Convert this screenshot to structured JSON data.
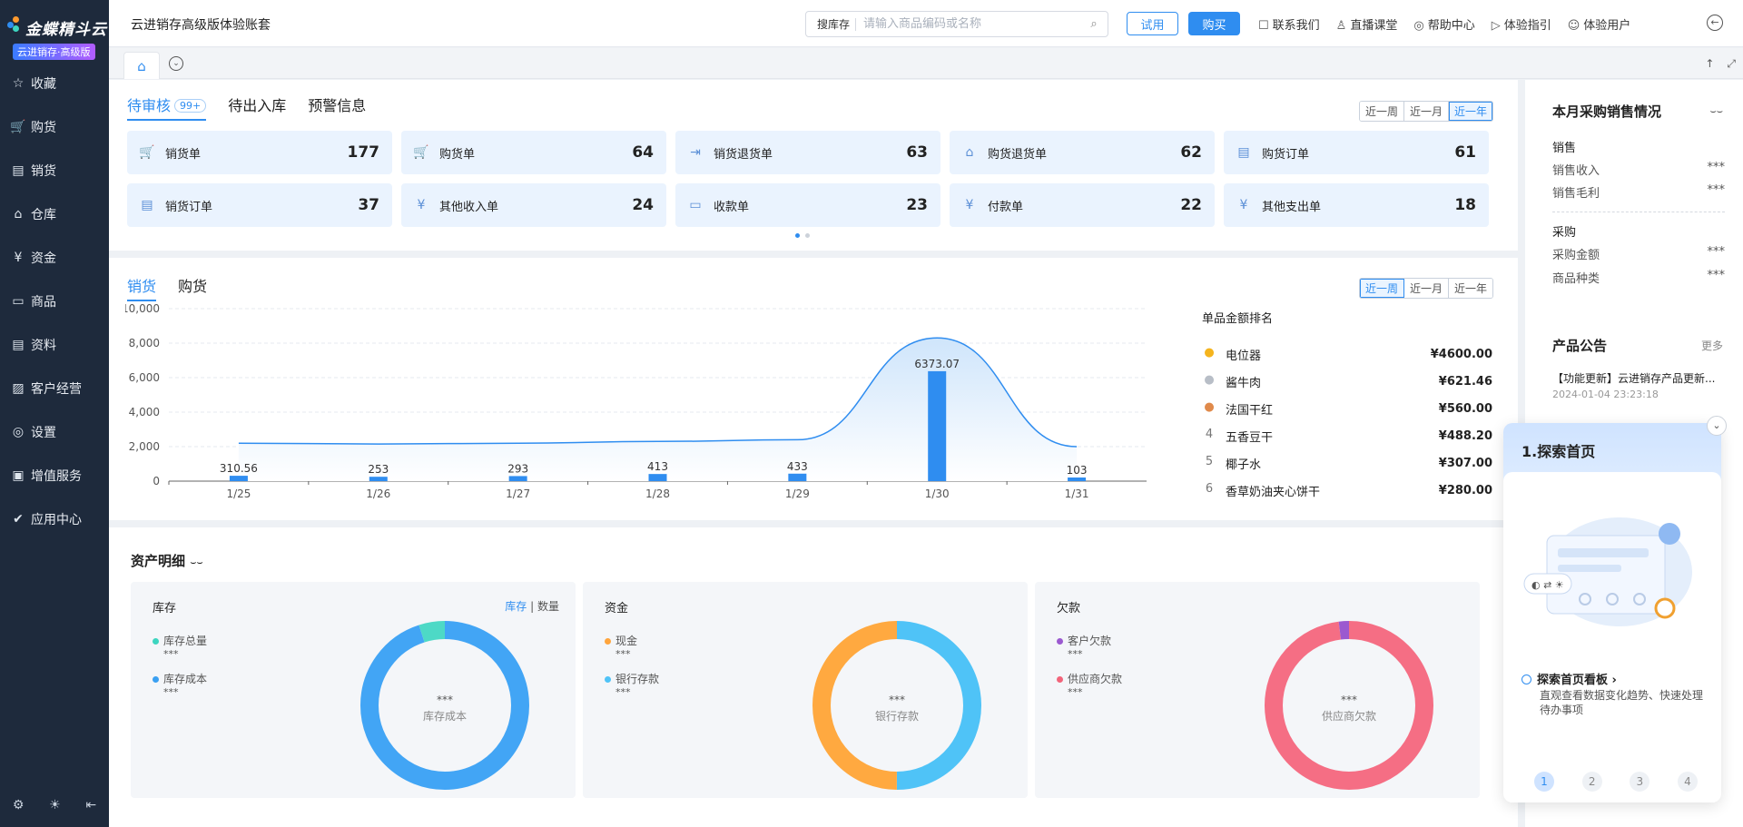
{
  "app": {
    "brand": "金蝶精斗云",
    "edition_badge": "云进销存·高级版",
    "account_name": "云进销存高级版体验账套"
  },
  "sidebar": {
    "items": [
      {
        "label": "收藏",
        "icon": "star-icon",
        "glyph": "☆"
      },
      {
        "label": "购货",
        "icon": "cart-icon",
        "glyph": "🛒"
      },
      {
        "label": "销货",
        "icon": "sales-doc-icon",
        "glyph": "▤"
      },
      {
        "label": "仓库",
        "icon": "warehouse-icon",
        "glyph": "⌂"
      },
      {
        "label": "资金",
        "icon": "yuan-icon",
        "glyph": "¥"
      },
      {
        "label": "商品",
        "icon": "box-icon",
        "glyph": "▭"
      },
      {
        "label": "资料",
        "icon": "doc-icon",
        "glyph": "▤"
      },
      {
        "label": "客户经营",
        "icon": "customer-icon",
        "glyph": "▨"
      },
      {
        "label": "设置",
        "icon": "settings-icon",
        "glyph": "◎"
      },
      {
        "label": "增值服务",
        "icon": "service-icon",
        "glyph": "▣"
      },
      {
        "label": "应用中心",
        "icon": "app-center-icon",
        "glyph": "✔"
      }
    ],
    "bottom": [
      "⚙",
      "☀",
      "⇤"
    ]
  },
  "topbar": {
    "search_scope": "搜库存",
    "search_placeholder": "请输入商品编码或名称",
    "try_label": "试用",
    "buy_label": "购买",
    "links": [
      {
        "label": "联系我们",
        "icon": "chat-icon",
        "glyph": "☐"
      },
      {
        "label": "直播课堂",
        "icon": "person-icon",
        "glyph": "♙"
      },
      {
        "label": "帮助中心",
        "icon": "compass-icon",
        "glyph": "◎"
      },
      {
        "label": "体验指引",
        "icon": "play-icon",
        "glyph": "▷"
      },
      {
        "label": "体验用户",
        "icon": "avatar-icon",
        "glyph": "☺"
      }
    ]
  },
  "pending": {
    "tabs": [
      "待审核",
      "待出入库",
      "预警信息"
    ],
    "badge": "99+",
    "ranges": [
      "近一周",
      "近一月",
      "近一年"
    ],
    "active_range": 2,
    "cards": [
      {
        "label": "销货单",
        "count": "177",
        "icon": "cart-icon",
        "glyph": "🛒"
      },
      {
        "label": "购货单",
        "count": "64",
        "icon": "cart-icon",
        "glyph": "🛒"
      },
      {
        "label": "销货退货单",
        "count": "63",
        "icon": "return-icon",
        "glyph": "⇥"
      },
      {
        "label": "购货退货单",
        "count": "62",
        "icon": "basket-icon",
        "glyph": "⌂"
      },
      {
        "label": "购货订单",
        "count": "61",
        "icon": "order-icon",
        "glyph": "▤"
      },
      {
        "label": "销货订单",
        "count": "37",
        "icon": "order-icon",
        "glyph": "▤"
      },
      {
        "label": "其他收入单",
        "count": "24",
        "icon": "income-icon",
        "glyph": "¥"
      },
      {
        "label": "收款单",
        "count": "23",
        "icon": "card-icon",
        "glyph": "▭"
      },
      {
        "label": "付款单",
        "count": "22",
        "icon": "payment-icon",
        "glyph": "¥"
      },
      {
        "label": "其他支出单",
        "count": "18",
        "icon": "expense-icon",
        "glyph": "¥"
      }
    ]
  },
  "sales": {
    "tabs": [
      "销货",
      "购货"
    ],
    "ranges": [
      "近一周",
      "近一月",
      "近一年"
    ],
    "active_range": 0,
    "rank_title": "单品金额排名",
    "rank": [
      {
        "rank": "1",
        "name": "电位器",
        "value": "¥4600.00",
        "medal": "gold"
      },
      {
        "rank": "2",
        "name": "酱牛肉",
        "value": "¥621.46",
        "medal": "silver"
      },
      {
        "rank": "3",
        "name": "法国干红",
        "value": "¥560.00",
        "medal": "bronze"
      },
      {
        "rank": "4",
        "name": "五香豆干",
        "value": "¥488.20",
        "medal": ""
      },
      {
        "rank": "5",
        "name": "椰子水",
        "value": "¥307.00",
        "medal": ""
      },
      {
        "rank": "6",
        "name": "香草奶油夹心饼干",
        "value": "¥280.00",
        "medal": ""
      }
    ]
  },
  "chart_data": {
    "type": "bar",
    "categories": [
      "1/25",
      "1/26",
      "1/27",
      "1/28",
      "1/29",
      "1/30",
      "1/31"
    ],
    "values": [
      310.56,
      253,
      293,
      413,
      433,
      6373.07,
      103
    ],
    "value_labels": [
      "310.56",
      "253",
      "293",
      "413",
      "433",
      "6373.07",
      "103"
    ],
    "trend_line": [
      2200,
      2150,
      2200,
      2300,
      2400,
      8300,
      2000
    ],
    "ylim": [
      0,
      10000
    ],
    "yticks": [
      "0",
      "2,000",
      "4,000",
      "6,000",
      "8,000",
      "10,000"
    ],
    "colors": {
      "bar": "#2f8df0",
      "line": "#2f8df0"
    }
  },
  "assets": {
    "title": "资产明细",
    "cards": [
      {
        "title": "库存",
        "toggle": [
          "库存",
          "数量"
        ],
        "legend": [
          {
            "label": "库存总量",
            "value": "***",
            "color": "#3dd5c0"
          },
          {
            "label": "库存成本",
            "value": "***",
            "color": "#3aa0f2"
          }
        ],
        "center_value": "***",
        "center_label": "库存成本",
        "segments": [
          {
            "share": 0.95,
            "color": "#42a5f5"
          },
          {
            "share": 0.05,
            "color": "#4dd9c6"
          }
        ]
      },
      {
        "title": "资金",
        "toggle": [],
        "legend": [
          {
            "label": "现金",
            "value": "***",
            "color": "#ffa53d"
          },
          {
            "label": "银行存款",
            "value": "***",
            "color": "#4fc3f7"
          }
        ],
        "center_value": "***",
        "center_label": "银行存款",
        "segments": [
          {
            "share": 0.5,
            "color": "#4fc3f7"
          },
          {
            "share": 0.5,
            "color": "#ffa940"
          }
        ]
      },
      {
        "title": "欠款",
        "toggle": [],
        "legend": [
          {
            "label": "客户欠款",
            "value": "***",
            "color": "#9b59d0"
          },
          {
            "label": "供应商欠款",
            "value": "***",
            "color": "#f2647a"
          }
        ],
        "center_value": "***",
        "center_label": "供应商欠款",
        "segments": [
          {
            "share": 0.98,
            "color": "#f56e84"
          },
          {
            "share": 0.02,
            "color": "#9b59d0"
          }
        ]
      }
    ]
  },
  "monthly": {
    "title": "本月采购销售情况",
    "sales_section": "销售",
    "sales_rows": [
      {
        "label": "销售收入",
        "value": "***"
      },
      {
        "label": "销售毛利",
        "value": "***"
      }
    ],
    "purchase_section": "采购",
    "purchase_rows": [
      {
        "label": "采购金额",
        "value": "***"
      },
      {
        "label": "商品种类",
        "value": "***"
      }
    ]
  },
  "notices": {
    "title": "产品公告",
    "more": "更多",
    "items": [
      {
        "title": "【功能更新】云进销存产品更新...",
        "date": "2024-01-04 23:23:18"
      }
    ]
  },
  "guide": {
    "title": "1.探索首页",
    "item_title": "探索首页看板",
    "item_desc": "直观查看数据变化趋势、快速处理待办事项",
    "steps": [
      "1",
      "2",
      "3",
      "4"
    ],
    "active_step": 0
  }
}
